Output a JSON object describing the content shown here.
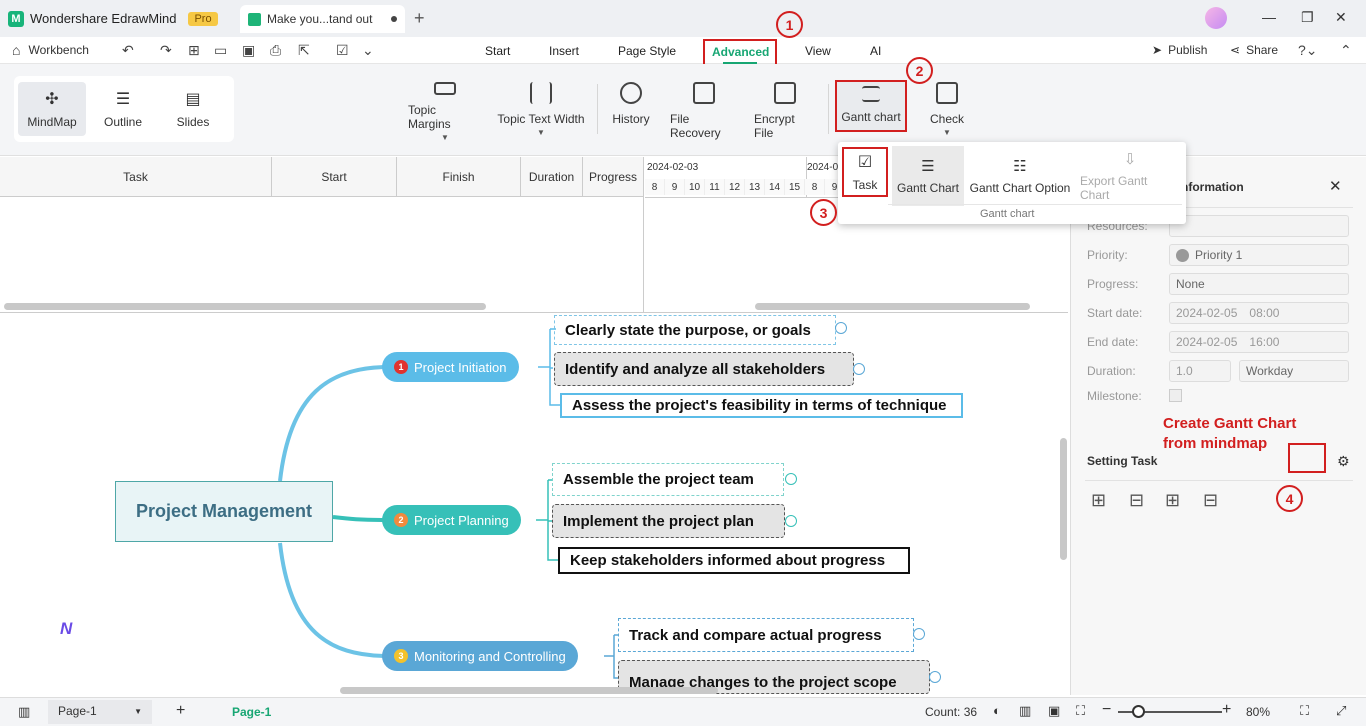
{
  "titlebar": {
    "app_name": "Wondershare EdrawMind",
    "pro_badge": "Pro",
    "doc_tab": "Make you...tand out"
  },
  "menubar": {
    "workbench": "Workbench",
    "items": [
      "Start",
      "Insert",
      "Page Style",
      "Advanced",
      "View",
      "AI"
    ],
    "publish": "Publish",
    "share": "Share"
  },
  "ribbon": {
    "views": [
      "MindMap",
      "Outline",
      "Slides"
    ],
    "tools": [
      "Topic Margins",
      "Topic Text Width",
      "History",
      "File Recovery",
      "Encrypt File",
      "Gantt chart",
      "Check"
    ]
  },
  "dropdown": {
    "items": [
      "Task",
      "Gantt Chart",
      "Gantt Chart Option",
      "Export Gantt Chart"
    ],
    "group_label": "Gantt chart"
  },
  "gantt": {
    "columns": [
      "Task",
      "Start",
      "Finish",
      "Duration",
      "Progress"
    ],
    "date1": "2024-02-03",
    "date2": "2024-0",
    "days": [
      "8",
      "9",
      "10",
      "11",
      "12",
      "13",
      "14",
      "15",
      "8",
      "9"
    ]
  },
  "panel": {
    "title": "nformation",
    "fields": {
      "resources": "Resources:",
      "priority_label": "Priority:",
      "priority_value": "Priority 1",
      "progress_label": "Progress:",
      "progress_value": "None",
      "start_label": "Start date:",
      "start_date": "2024-02-05",
      "start_time": "08:00",
      "end_label": "End date:",
      "end_date": "2024-02-05",
      "end_time": "16:00",
      "duration_label": "Duration:",
      "duration_value": "1.0",
      "duration_unit": "Workday",
      "milestone_label": "Milestone:"
    },
    "setting_task": "Setting Task",
    "annotation": "Create Gantt Chart from mindmap"
  },
  "mindmap": {
    "root": "Project Management",
    "branches": [
      {
        "num": "1",
        "label": "Project Initiation",
        "color": "#5bbce8",
        "badge": "#e0332f",
        "children": [
          "Clearly state the purpose, or goals",
          "Identify and analyze all stakeholders",
          "Assess the project's feasibility in terms of technique"
        ]
      },
      {
        "num": "2",
        "label": "Project Planning",
        "color": "#36c0b8",
        "badge": "#f08a3e",
        "children": [
          "Assemble the project team",
          "Implement the project plan",
          "Keep stakeholders informed about progress"
        ]
      },
      {
        "num": "3",
        "label": "Monitoring and Controlling",
        "color": "#5aa7d6",
        "badge": "#f3c22b",
        "children": [
          "Track and compare actual progress",
          "Manage changes to the project scope"
        ]
      }
    ]
  },
  "annotations": [
    "1",
    "2",
    "3",
    "4"
  ],
  "statusbar": {
    "page_select": "Page-1",
    "page_tab": "Page-1",
    "count": "Count: 36",
    "zoom": "80%"
  }
}
